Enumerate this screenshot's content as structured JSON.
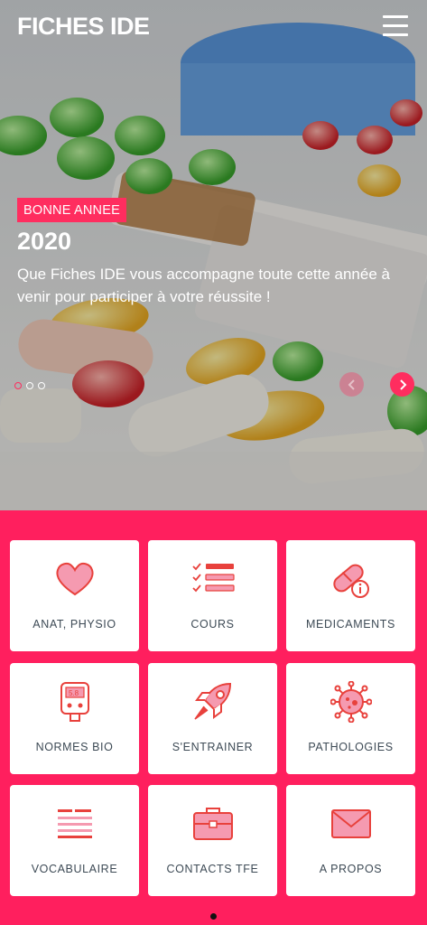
{
  "header": {
    "app_title": "FICHES IDE",
    "menu_icon": "hamburger-menu-icon"
  },
  "slide": {
    "badge": "BONNE ANNEE",
    "headline": "2020",
    "text": "Que Fiches IDE vous accompagne toute cette année à venir pour participer à votre réussite !",
    "indicator_count": 3,
    "active_index": 0
  },
  "tiles": [
    {
      "label": "ANAT, PHYSIO",
      "icon": "heart-icon"
    },
    {
      "label": "COURS",
      "icon": "checklist-icon"
    },
    {
      "label": "MEDICAMENTS",
      "icon": "pill-info-icon"
    },
    {
      "label": "NORMES BIO",
      "icon": "glucometer-icon"
    },
    {
      "label": "S'ENTRAINER",
      "icon": "rocket-icon"
    },
    {
      "label": "PATHOLOGIES",
      "icon": "virus-icon"
    },
    {
      "label": "VOCABULAIRE",
      "icon": "text-lines-icon"
    },
    {
      "label": "CONTACTS TFE",
      "icon": "briefcase-icon"
    },
    {
      "label": "A PROPOS",
      "icon": "envelope-icon"
    }
  ],
  "colors": {
    "accent": "#ff1f5e",
    "icon_red": "#e8413c",
    "icon_pink": "#f59ab0"
  }
}
